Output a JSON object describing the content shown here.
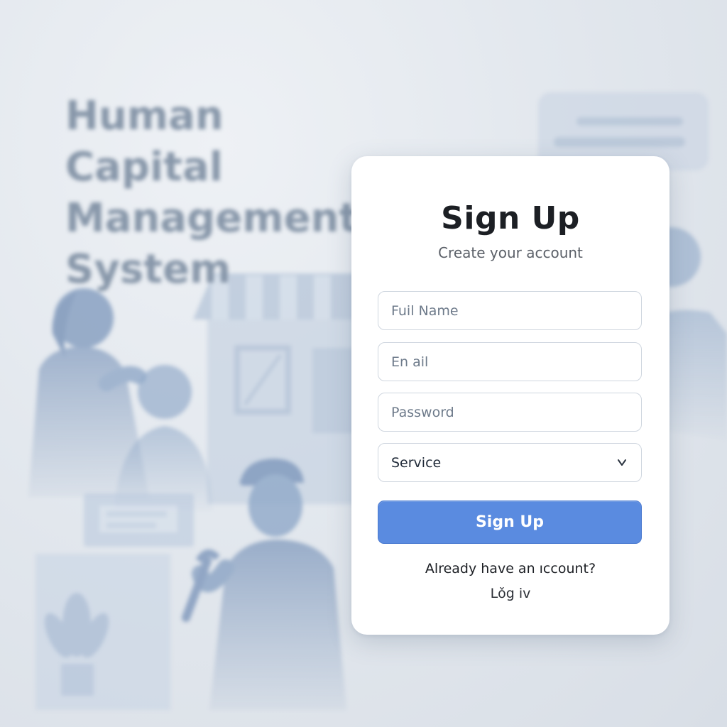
{
  "hero": {
    "title": "Human Capital\nManagement\nSystem"
  },
  "form": {
    "title": "Sign Up",
    "subtitle": "Create your account",
    "full_name_placeholder": "Fuil Name",
    "email_placeholder": "En ail",
    "password_placeholder": "Password",
    "service_selected": "Service",
    "submit_label": "Sign Up",
    "already_text": "Already have an ıccount?",
    "login_label": "Lǒg iv"
  },
  "colors": {
    "accent": "#5a8be0",
    "background": "#dfe4ea",
    "card": "#ffffff",
    "illustration": "#8fa8c8"
  },
  "icons": {
    "select_chevron": "chevron-down-icon"
  }
}
